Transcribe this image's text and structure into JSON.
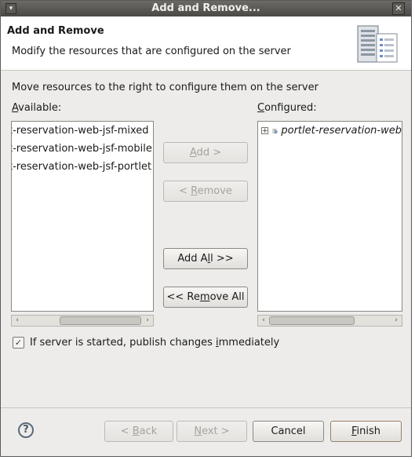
{
  "window": {
    "title": "Add and Remove..."
  },
  "banner": {
    "title": "Add and Remove",
    "description": "Modify the resources that are configured on the server"
  },
  "instructions": "Move resources to the right to configure them on the server",
  "available": {
    "label_u": "A",
    "label_rest": "vailable:",
    "items": [
      "t-reservation-web-jsf-mixed",
      "t-reservation-web-jsf-mobile",
      "t-reservation-web-jsf-portlet"
    ]
  },
  "configured": {
    "label_u": "C",
    "label_rest": "onfigured:",
    "items": [
      "portlet-reservation-web"
    ]
  },
  "buttons": {
    "add": {
      "pre": "",
      "u": "A",
      "post": "dd >"
    },
    "remove": {
      "pre": "< ",
      "u": "R",
      "post": "emove"
    },
    "add_all": {
      "pre": "Add A",
      "u": "l",
      "post": "l >>"
    },
    "remove_all": {
      "pre": "<< Re",
      "u": "m",
      "post": "ove All"
    },
    "back": {
      "pre": "< ",
      "u": "B",
      "post": "ack"
    },
    "next": {
      "pre": "",
      "u": "N",
      "post": "ext >"
    },
    "cancel": "Cancel",
    "finish": {
      "pre": "",
      "u": "F",
      "post": "inish"
    }
  },
  "checkbox": {
    "checked": true,
    "pre": "If server is started, publish changes ",
    "u": "i",
    "post": "mmediately"
  },
  "icons": {
    "help": "help-icon",
    "server": "server-config-icon",
    "project": "web-project-icon"
  }
}
